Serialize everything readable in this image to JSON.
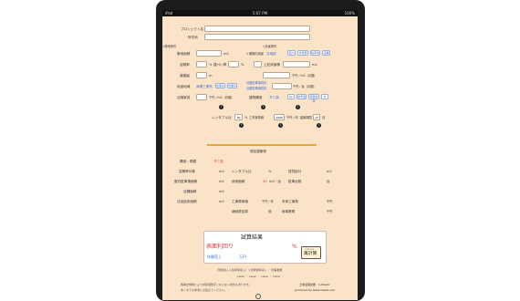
{
  "status_bar": {
    "carrier": "iPad",
    "time": "5:07 PM",
    "battery": "100%"
  },
  "form": {
    "project_label": "プロジェクト名",
    "location_label": "所在地",
    "land_section": "▽敷地条件",
    "building_section": "▽計画条件",
    "site_area_label": "敷地面積",
    "site_area_unit": "m2",
    "frontage_label": "1 期縁内用途",
    "frontage_value": "共用部",
    "btn_a": "室内",
    "btn_b": "共用部",
    "btn_c": "駐車場",
    "btn_d": "店舗",
    "coverage_label": "容積率",
    "coverage_unit": "%",
    "coverage_note": "建ぺい率",
    "floors_label": "上記床面積",
    "floors_unit": "m2",
    "road_label": "道路幅",
    "road_unit": "m",
    "rent_label": "千円／m2（月額）",
    "zoning_label": "用途地域",
    "zoning_value": "商業工業系",
    "zoning_btn1": "住居系",
    "zoning_btn2": "商業系",
    "zoning_link": "近隣駐車場賃料",
    "zoning_link2": "近隣駐車場賃料",
    "zoning_rent_unit": "千円／台（月額）",
    "price_label": "近隣家賃",
    "price_unit": "千円／m2（月額）",
    "structure_label": "建物構造",
    "structure_value": "ＲＣ造",
    "struct_btn1": "RC",
    "struct_btn2": "鉄骨造",
    "struct_btn3": "軽量鉄骨",
    "struct_btn4": "木",
    "ratio_label": "レンタブル比",
    "ratio_value": "90",
    "ratio_unit": "%",
    "cost_label": "工事費単価",
    "cost_value": "1000",
    "cost_unit": "千円／坪",
    "period_label": "建築期間",
    "period_value": "12",
    "period_unit": "月"
  },
  "summary": {
    "title": "想定建築物",
    "structure_label": "構造・規模",
    "structure_value": "ＲＣ造",
    "volume_label": "容積率対象",
    "volume_unit": "m2",
    "rentable_label": "レンタブル比",
    "rentable_unit": "%",
    "lease_label": "賃貸部分",
    "lease_unit": "m2",
    "parking_label": "屋内駐車場面積",
    "parking_unit": "m2",
    "used_label": "使用面積",
    "used_value": "30",
    "used_unit": "m2／台",
    "spaces_label": "駐車台数",
    "spaces_unit": "台",
    "shop_label": "店舗面積",
    "shop_unit": "m2",
    "total_label": "法延延床面積",
    "total_unit": "m2",
    "unitcost_label": "工事費単価",
    "unitcost_unit": "千円／坪",
    "body_cost_label": "本体工事費",
    "body_cost_unit": "千円",
    "additional_label": "諸経費加算",
    "additional_unit": "倍",
    "project_cost_label": "総事業費",
    "project_cost_unit": "千円"
  },
  "result": {
    "title": "試算結果",
    "yield_label": "表面利回り",
    "yield_unit": "%",
    "sales_label": "年間売上",
    "sales_unit": "万円",
    "recalc_top": "V-Check",
    "recalc_label": "再計算"
  },
  "footer": {
    "formula": "（家賃収入＋駐車場収入）×近隣賃料収入 ／ 総事業費",
    "labels": "Label ・ Label ・ Label ・ Label",
    "note1": "各種法規制により試算値数字とならない場合もあります。",
    "note2": "あくまでも参考にお役立てください。",
    "brand": "土地活用診断　V-Check",
    "produced": "produced by www.mukai.com"
  }
}
